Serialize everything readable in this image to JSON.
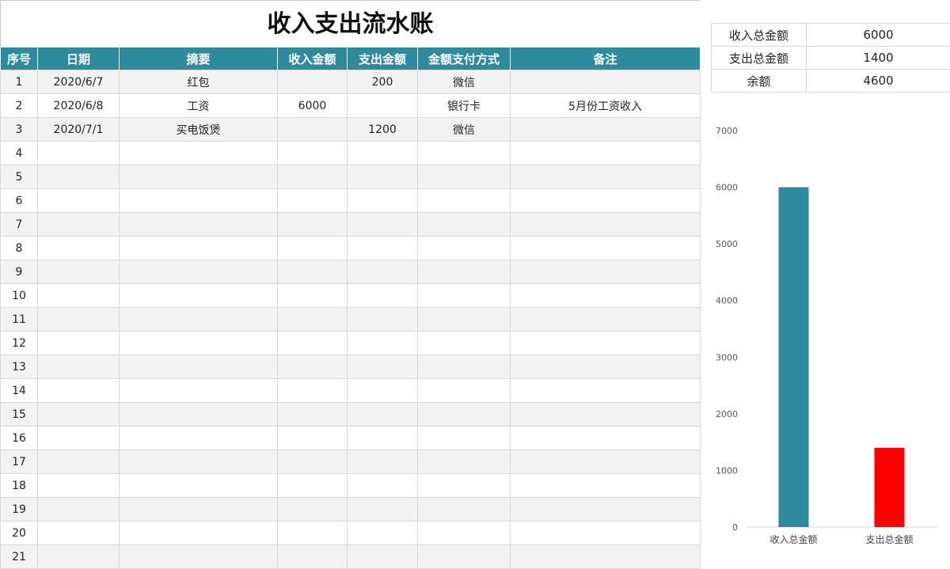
{
  "title": "收入支出流水账",
  "ledger": {
    "headers": [
      "序号",
      "日期",
      "摘要",
      "收入金额",
      "支出金额",
      "金额支付方式",
      "备注"
    ],
    "rows": [
      [
        "1",
        "2020/6/7",
        "红包",
        "",
        "200",
        "微信",
        ""
      ],
      [
        "2",
        "2020/6/8",
        "工资",
        "6000",
        "",
        "银行卡",
        "5月份工资收入"
      ],
      [
        "3",
        "2020/7/1",
        "买电饭煲",
        "",
        "1200",
        "微信",
        ""
      ],
      [
        "4",
        "",
        "",
        "",
        "",
        "",
        ""
      ],
      [
        "5",
        "",
        "",
        "",
        "",
        "",
        ""
      ],
      [
        "6",
        "",
        "",
        "",
        "",
        "",
        ""
      ],
      [
        "7",
        "",
        "",
        "",
        "",
        "",
        ""
      ],
      [
        "8",
        "",
        "",
        "",
        "",
        "",
        ""
      ],
      [
        "9",
        "",
        "",
        "",
        "",
        "",
        ""
      ],
      [
        "10",
        "",
        "",
        "",
        "",
        "",
        ""
      ],
      [
        "11",
        "",
        "",
        "",
        "",
        "",
        ""
      ],
      [
        "12",
        "",
        "",
        "",
        "",
        "",
        ""
      ],
      [
        "13",
        "",
        "",
        "",
        "",
        "",
        ""
      ],
      [
        "14",
        "",
        "",
        "",
        "",
        "",
        ""
      ],
      [
        "15",
        "",
        "",
        "",
        "",
        "",
        ""
      ],
      [
        "16",
        "",
        "",
        "",
        "",
        "",
        ""
      ],
      [
        "17",
        "",
        "",
        "",
        "",
        "",
        ""
      ],
      [
        "18",
        "",
        "",
        "",
        "",
        "",
        ""
      ],
      [
        "19",
        "",
        "",
        "",
        "",
        "",
        ""
      ],
      [
        "20",
        "",
        "",
        "",
        "",
        "",
        ""
      ],
      [
        "21",
        "",
        "",
        "",
        "",
        "",
        ""
      ]
    ]
  },
  "summary": [
    {
      "label": "收入总金额",
      "value": "6000"
    },
    {
      "label": "支出总金额",
      "value": "1400"
    },
    {
      "label": "余额",
      "value": "4600"
    }
  ],
  "colors": {
    "header_bg": "#2e8b9e",
    "income_bar": "#2e8b9e",
    "expense_bar": "#ff0000",
    "expense_text": "#ff1a1a"
  },
  "chart_data": {
    "type": "bar",
    "categories": [
      "收入总金额",
      "支出总金额"
    ],
    "values": [
      6000,
      1400
    ],
    "bar_colors": [
      "#2e8b9e",
      "#ff0000"
    ],
    "ylim": [
      0,
      7000
    ],
    "yticks": [
      0,
      1000,
      2000,
      3000,
      4000,
      5000,
      6000,
      7000
    ],
    "title": "",
    "xlabel": "",
    "ylabel": "",
    "grid": false,
    "legend": "none"
  }
}
